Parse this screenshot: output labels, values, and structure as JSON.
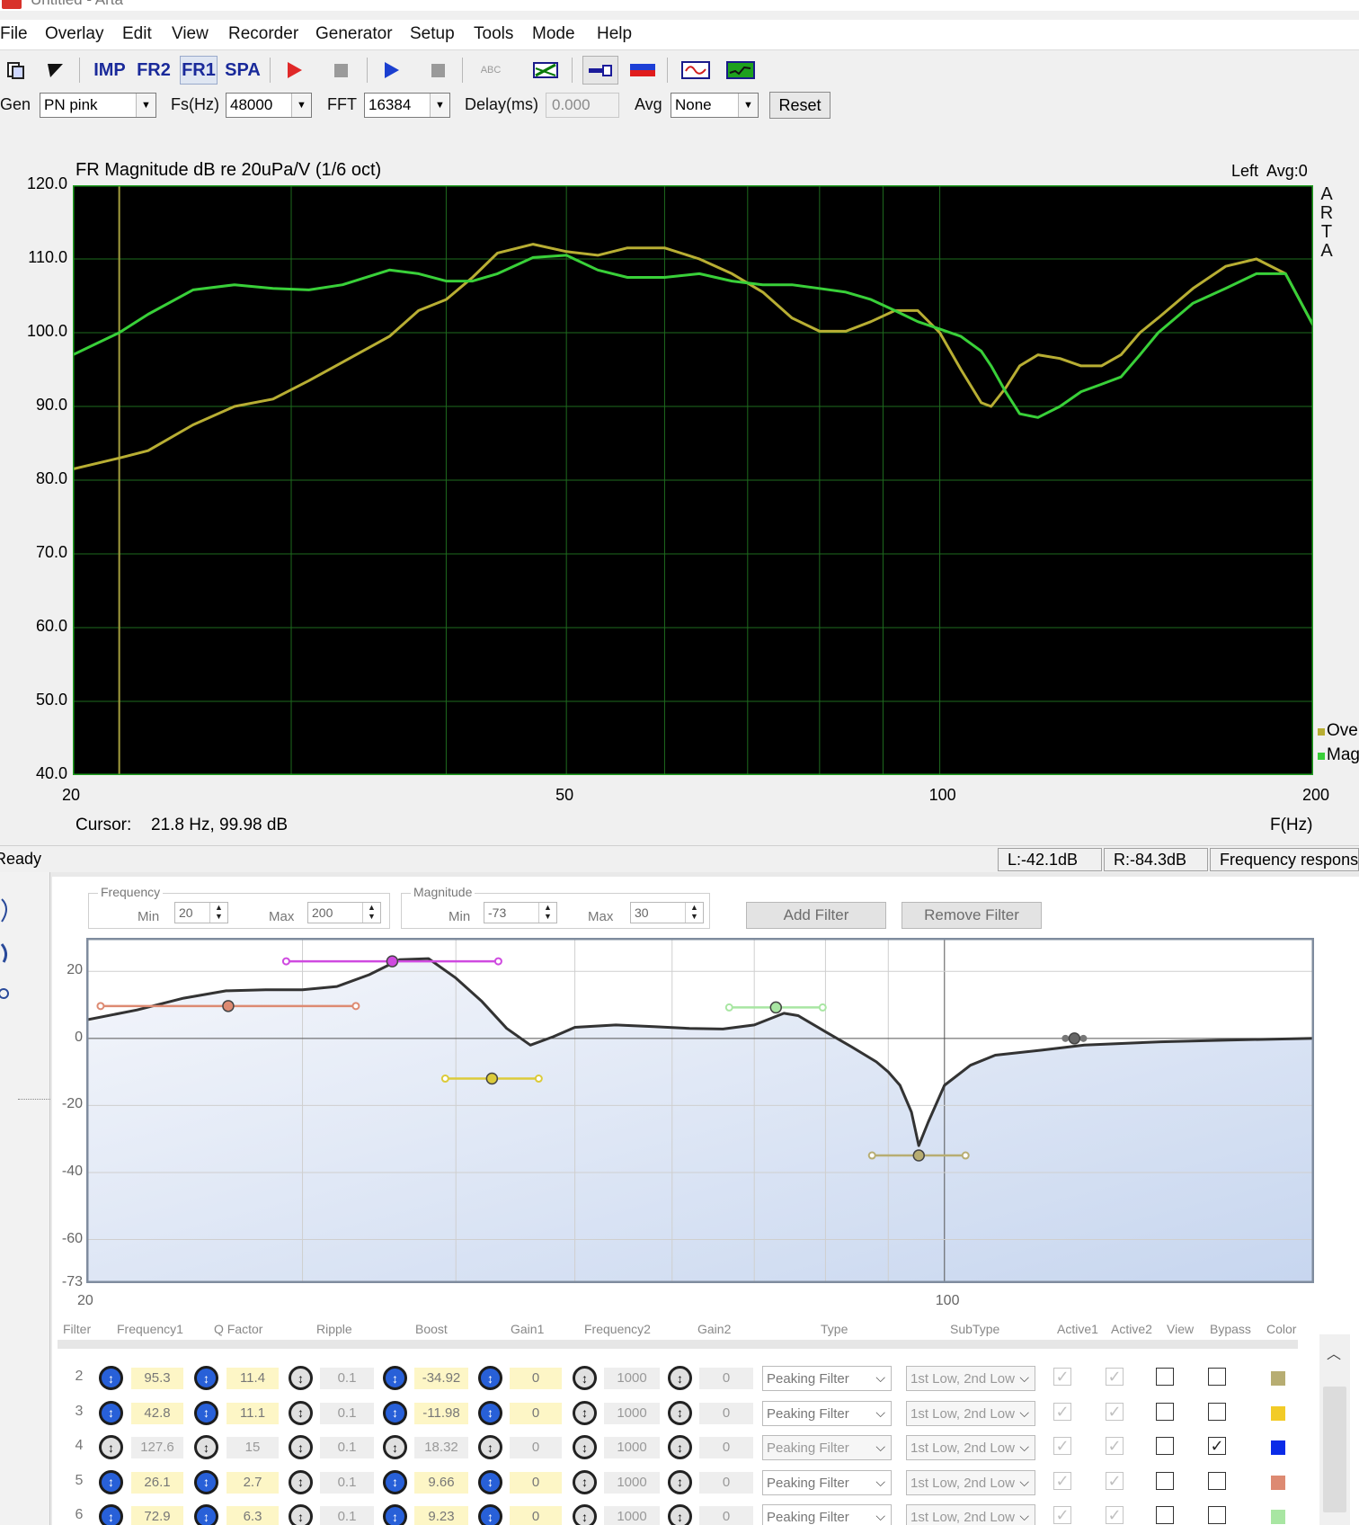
{
  "window": {
    "title": "Untitled - Arta"
  },
  "menu": [
    "File",
    "Overlay",
    "Edit",
    "View",
    "Recorder",
    "Generator",
    "Setup",
    "Tools",
    "Mode",
    "Help"
  ],
  "toolbar": {
    "imp": "IMP",
    "fr2": "FR2",
    "fr1": "FR1",
    "spa": "SPA",
    "abc": "ABC"
  },
  "gen_bar": {
    "gen_label": "Gen",
    "gen_value": "PN pink",
    "fs_label": "Fs(Hz)",
    "fs_value": "48000",
    "fft_label": "FFT",
    "fft_value": "16384",
    "delay_label": "Delay(ms)",
    "delay_value": "0.000",
    "avg_label": "Avg",
    "avg_value": "None",
    "reset_label": "Reset"
  },
  "fr_chart": {
    "title": "FR Magnitude dB re 20uPa/V (1/6 oct)",
    "channel_info": "Left  Avg:0",
    "brand_letters": [
      "A",
      "R",
      "T",
      "A"
    ],
    "cursor_label": "Cursor:",
    "cursor_value": "21.8 Hz, 99.98 dB",
    "x_axis_label": "F(Hz)",
    "legend": [
      "Ove",
      "Mag"
    ],
    "colors": {
      "background": "#000000",
      "grid": "#1e6b1e",
      "frame": "#22a022",
      "overlay": "#b8ae33",
      "magnitude": "#39d039",
      "cursor": "#a39d3d"
    }
  },
  "chart_data": {
    "type": "line",
    "title": "FR Magnitude dB re 20uPa/V (1/6 oct)",
    "xlabel": "F(Hz)",
    "ylabel": "",
    "xscale": "log",
    "xlim": [
      20,
      200
    ],
    "ylim": [
      40,
      120
    ],
    "x_tick_labels": [
      "20",
      "50",
      "100",
      "200"
    ],
    "x_ticks": [
      20,
      50,
      100,
      200
    ],
    "y_tick_labels": [
      "120.0",
      "110.0",
      "100.0",
      "90.0",
      "80.0",
      "70.0",
      "60.0",
      "50.0",
      "40.0"
    ],
    "y_ticks": [
      120,
      110,
      100,
      90,
      80,
      70,
      60,
      50,
      40
    ],
    "grid": true,
    "legend_position": "bottom-right",
    "cursor_x": 21.8,
    "series": [
      {
        "name": "Ove",
        "color": "#b8ae33",
        "x": [
          20,
          21.8,
          23,
          25,
          27,
          29,
          31,
          33,
          36,
          38,
          40,
          42,
          44,
          47,
          50,
          53,
          56,
          60,
          64,
          68,
          72,
          76,
          80,
          84,
          88,
          92,
          96,
          100,
          104,
          108,
          110,
          113,
          116,
          120,
          125,
          130,
          135,
          140,
          145,
          150,
          160,
          170,
          180,
          190,
          200
        ],
        "y": [
          81.5,
          83,
          84,
          87.5,
          90,
          91,
          93.5,
          96,
          99.5,
          103,
          104.5,
          107.5,
          110.8,
          112,
          111,
          110.5,
          111.5,
          111.5,
          110,
          108,
          105.5,
          102,
          100.2,
          100.2,
          101.5,
          103,
          103,
          100,
          95,
          90.5,
          90,
          92.5,
          95.5,
          97,
          96.5,
          95.5,
          95.5,
          97,
          100,
          102,
          106,
          109,
          110,
          108,
          101
        ]
      },
      {
        "name": "Mag",
        "color": "#39d039",
        "x": [
          20,
          21.8,
          23,
          25,
          27,
          29,
          31,
          33,
          36,
          38,
          40,
          42,
          44,
          47,
          50,
          53,
          56,
          60,
          64,
          68,
          72,
          76,
          80,
          84,
          88,
          92,
          96,
          100,
          104,
          108,
          110,
          113,
          116,
          120,
          125,
          130,
          135,
          140,
          145,
          150,
          160,
          170,
          180,
          190,
          200
        ],
        "y": [
          97,
          100,
          102.5,
          105.8,
          106.5,
          106,
          105.8,
          106.5,
          108.5,
          108,
          107,
          107,
          108,
          110.2,
          110.5,
          108.5,
          107.5,
          107.5,
          108,
          107,
          106.5,
          106.5,
          106,
          105.5,
          104.5,
          103,
          101.5,
          100.5,
          99.5,
          97.5,
          95.5,
          92,
          89,
          88.5,
          90,
          92,
          93,
          94,
          97,
          100,
          104,
          106,
          108,
          108,
          101
        ]
      }
    ]
  },
  "status": {
    "left": "Ready",
    "l_level": "L:-42.1dB",
    "r_level": "R:-84.3dB",
    "mode": "Frequency response"
  },
  "eq": {
    "freq_group": "Frequency",
    "mag_group": "Magnitude",
    "min_label": "Min",
    "max_label": "Max",
    "freq_min": "20",
    "freq_max": "200",
    "mag_min": "-73",
    "mag_max": "30",
    "add_filter": "Add Filter",
    "remove_filter": "Remove Filter",
    "y_tick_labels": [
      "20",
      "0",
      "-20",
      "-40",
      "-60",
      "-73"
    ],
    "x_tick_labels": [
      "20",
      "100"
    ],
    "colors": {
      "fill_top": "#f4f6fb",
      "fill_bottom": "#c7d6ef",
      "curve": "#333333"
    }
  },
  "eq_chart_data": {
    "type": "line",
    "xscale": "log",
    "xlim": [
      20,
      200
    ],
    "ylim": [
      -73,
      30
    ],
    "y_ticks": [
      20,
      0,
      -20,
      -40,
      -60,
      -73
    ],
    "x_ticks": [
      20,
      100
    ],
    "curve": {
      "x": [
        20,
        22,
        24,
        26,
        28,
        30,
        32,
        34,
        36,
        38,
        40,
        42,
        44,
        46,
        48,
        50,
        54,
        58,
        62,
        66,
        70,
        74,
        76,
        80,
        84,
        88,
        90,
        92,
        94,
        95.3,
        97,
        100,
        105,
        110,
        120,
        130,
        150,
        170,
        200
      ],
      "y": [
        5.5,
        8.5,
        12,
        14.2,
        14.5,
        14.5,
        15.5,
        19,
        23.5,
        23.8,
        18,
        11,
        3,
        -2,
        0.5,
        3.3,
        4,
        3.5,
        3,
        2.8,
        4,
        7.5,
        6.8,
        2,
        -2.5,
        -7,
        -10,
        -14,
        -22,
        -32,
        -25,
        -14,
        -8,
        -5,
        -3.5,
        -2,
        -1,
        -0.5,
        0
      ]
    },
    "handles": [
      {
        "freq": 26.1,
        "gain": 9.66,
        "color": "#dd8a72"
      },
      {
        "freq": 35.5,
        "gain": 23,
        "color": "#cf4ae0"
      },
      {
        "freq": 42.8,
        "gain": -11.98,
        "color": "#dccb3a"
      },
      {
        "freq": 72.9,
        "gain": 9.23,
        "color": "#a8e6a2"
      },
      {
        "freq": 95.3,
        "gain": -34.92,
        "color": "#b7ad72"
      },
      {
        "freq": 127.6,
        "gain": 0,
        "color": "#666666"
      }
    ]
  },
  "table": {
    "headers": [
      "Filter",
      "Frequency1",
      "Q Factor",
      "Ripple",
      "Boost",
      "Gain1",
      "Frequency2",
      "Gain2",
      "Type",
      "SubType",
      "Active1",
      "Active2",
      "View",
      "Bypass",
      "Color"
    ],
    "rows": [
      {
        "idx": "2",
        "freq1": "95.3",
        "q": "11.4",
        "ripple": "0.1",
        "boost": "-34.92",
        "gain1": "0",
        "freq2": "1000",
        "gain2": "0",
        "type": "Peaking Filter",
        "subtype": "1st Low, 2nd Low",
        "active1": "✓",
        "active2": "✓",
        "view": "",
        "bypass": "",
        "color": "#b7ad72",
        "enabled": true
      },
      {
        "idx": "3",
        "freq1": "42.8",
        "q": "11.1",
        "ripple": "0.1",
        "boost": "-11.98",
        "gain1": "0",
        "freq2": "1000",
        "gain2": "0",
        "type": "Peaking Filter",
        "subtype": "1st Low, 2nd Low",
        "active1": "✓",
        "active2": "✓",
        "view": "",
        "bypass": "",
        "color": "#f2cb27",
        "enabled": true
      },
      {
        "idx": "4",
        "freq1": "127.6",
        "q": "15",
        "ripple": "0.1",
        "boost": "18.32",
        "gain1": "0",
        "freq2": "1000",
        "gain2": "0",
        "type": "Peaking Filter",
        "subtype": "1st Low, 2nd Low",
        "active1": "✓",
        "active2": "✓",
        "view": "",
        "bypass": "✓",
        "color": "#0a2be8",
        "enabled": false
      },
      {
        "idx": "5",
        "freq1": "26.1",
        "q": "2.7",
        "ripple": "0.1",
        "boost": "9.66",
        "gain1": "0",
        "freq2": "1000",
        "gain2": "0",
        "type": "Peaking Filter",
        "subtype": "1st Low, 2nd Low",
        "active1": "✓",
        "active2": "✓",
        "view": "",
        "bypass": "",
        "color": "#dd8a72",
        "enabled": true
      },
      {
        "idx": "6",
        "freq1": "72.9",
        "q": "6.3",
        "ripple": "0.1",
        "boost": "9.23",
        "gain1": "0",
        "freq2": "1000",
        "gain2": "0",
        "type": "Peaking Filter",
        "subtype": "1st Low, 2nd Low",
        "active1": "✓",
        "active2": "✓",
        "view": "",
        "bypass": "",
        "color": "#a8e6a2",
        "enabled": true
      }
    ]
  }
}
